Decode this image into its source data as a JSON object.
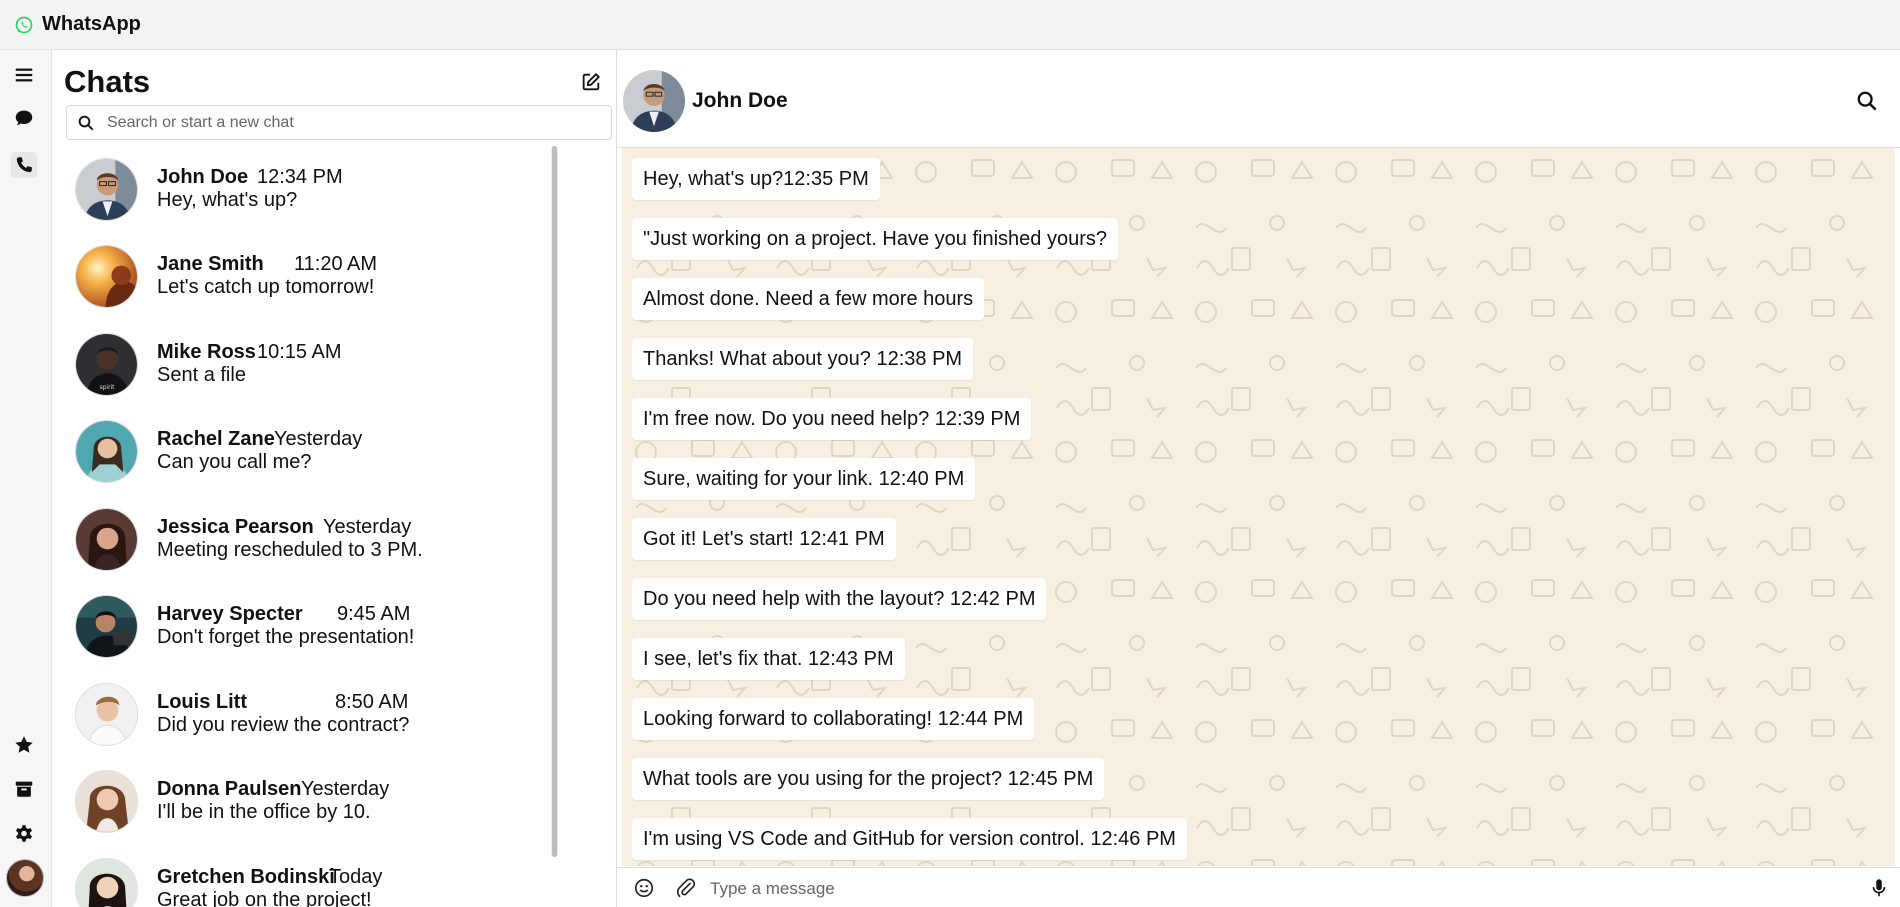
{
  "app": {
    "title": "WhatsApp",
    "accent": "#25D366"
  },
  "rail": {
    "icons": [
      "menu-icon",
      "chats-icon",
      "calls-icon",
      "starred-icon",
      "archive-icon",
      "settings-icon"
    ]
  },
  "chatlist": {
    "title": "Chats",
    "search_placeholder": "Search or start a new chat",
    "items": [
      {
        "name": "John Doe",
        "time": "12:34 PM",
        "message": "Hey, what's up?"
      },
      {
        "name": "Jane Smith",
        "time": "11:20 AM",
        "message": "Let's catch up tomorrow!"
      },
      {
        "name": "Mike Ross",
        "time": "10:15 AM",
        "message": "Sent a file"
      },
      {
        "name": "Rachel Zane",
        "time": "Yesterday",
        "message": "Can you call me?"
      },
      {
        "name": "Jessica Pearson",
        "time": "Yesterday",
        "message": "Meeting rescheduled to 3 PM."
      },
      {
        "name": "Harvey Specter",
        "time": "9:45 AM",
        "message": "Don't forget the presentation!"
      },
      {
        "name": "Louis Litt",
        "time": "8:50 AM",
        "message": "Did you review the contract?"
      },
      {
        "name": "Donna Paulsen",
        "time": "Yesterday",
        "message": "I'll be in the office by 10."
      },
      {
        "name": "Gretchen Bodinski",
        "time": "Today",
        "message": "Great job on the project!"
      }
    ]
  },
  "chat": {
    "contact_name": "John Doe",
    "messages": [
      "Hey, what's up?12:35 PM",
      "\"Just working on a project. Have you finished yours?",
      "Almost done. Need a few more hours",
      "Thanks! What about you? 12:38 PM",
      "I'm free now. Do you need help? 12:39 PM",
      "Sure, waiting for your link. 12:40 PM",
      "Got it! Let's start! 12:41 PM",
      "Do you need help with the layout? 12:42 PM",
      "I see, let's fix that. 12:43 PM",
      "Looking forward to collaborating! 12:44 PM",
      "What tools are you using for the project? 12:45 PM",
      "I'm using VS Code and GitHub for version control. 12:46 PM"
    ],
    "composer_placeholder": "Type a message"
  }
}
